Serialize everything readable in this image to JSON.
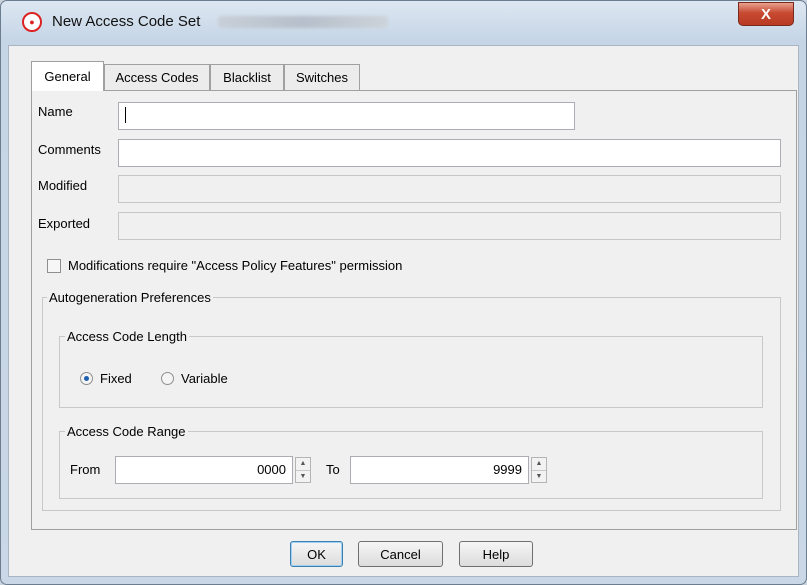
{
  "window": {
    "title": "New Access Code Set",
    "close_label": "X"
  },
  "tabs": [
    {
      "label": "General",
      "active": true
    },
    {
      "label": "Access Codes",
      "active": false
    },
    {
      "label": "Blacklist",
      "active": false
    },
    {
      "label": "Switches",
      "active": false
    }
  ],
  "general": {
    "name_label": "Name",
    "name_value": "",
    "comments_label": "Comments",
    "comments_value": "",
    "modified_label": "Modified",
    "modified_value": "",
    "exported_label": "Exported",
    "exported_value": "",
    "permission_checkbox_label": "Modifications require \"Access Policy Features\" permission",
    "permission_checked": false
  },
  "autogen": {
    "title": "Autogeneration Preferences",
    "length": {
      "title": "Access Code Length",
      "fixed_label": "Fixed",
      "variable_label": "Variable",
      "selected": "Fixed"
    },
    "range": {
      "title": "Access Code Range",
      "from_label": "From",
      "from_value": "0000",
      "to_label": "To",
      "to_value": "9999"
    }
  },
  "buttons": {
    "ok": "OK",
    "cancel": "Cancel",
    "help": "Help"
  }
}
